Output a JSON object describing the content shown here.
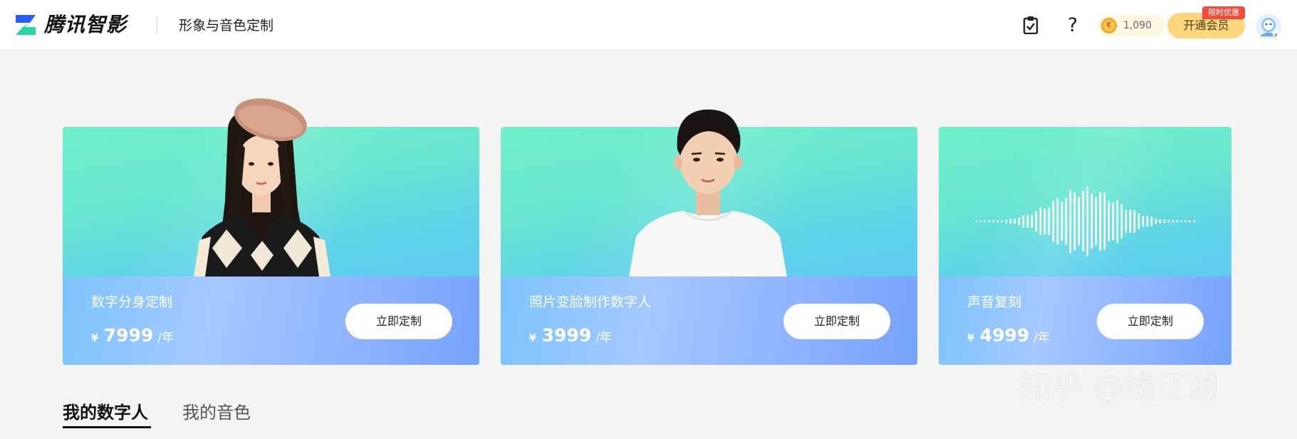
{
  "header": {
    "brand_name": "腾讯智影",
    "page_title": "形象与音色定制",
    "coins": "1,090",
    "vip_label": "开通会员",
    "promo_label": "限时优惠"
  },
  "cards": [
    {
      "title": "数字分身定制",
      "currency": "¥",
      "price": "7999",
      "unit": "/年",
      "button": "立即定制"
    },
    {
      "title": "照片变脸制作数字人",
      "currency": "¥",
      "price": "3999",
      "unit": "/年",
      "button": "立即定制"
    },
    {
      "title": "声音复刻",
      "currency": "¥",
      "price": "4999",
      "unit": "/年",
      "button": "立即定制"
    }
  ],
  "tabs": [
    {
      "label": "我的数字人",
      "active": true
    },
    {
      "label": "我的音色",
      "active": false
    }
  ],
  "watermark": "知乎 @栈江湖",
  "icons": [
    "logo-icon",
    "clipboard-check-icon",
    "help-icon",
    "coin-icon",
    "avatar"
  ],
  "colors": {
    "card_top": "#6ff0c9",
    "card_bottom": "#5abdf6",
    "vip_button": "#ffd57d",
    "promo_tag": "#f14b3c",
    "logo_blue": "#2a5cff",
    "logo_green": "#27d6a5"
  }
}
